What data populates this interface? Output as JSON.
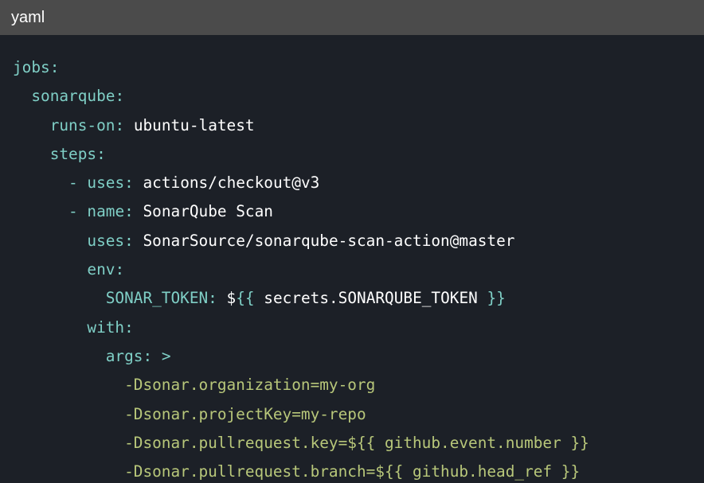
{
  "header": {
    "language": "yaml"
  },
  "code": {
    "lines": [
      {
        "key": "jobs",
        "sep": ":"
      },
      {
        "key": "sonarqube",
        "sep": ":"
      },
      {
        "key": "runs-on",
        "sep": ":",
        "value": "ubuntu-latest"
      },
      {
        "key": "steps",
        "sep": ":"
      },
      {
        "dash": "-",
        "key": "uses",
        "sep": ":",
        "value": "actions/checkout@v3"
      },
      {
        "dash": "-",
        "key": "name",
        "sep": ":",
        "value": "SonarQube Scan"
      },
      {
        "key": "uses",
        "sep": ":",
        "value": "SonarSource/sonarqube-scan-action@master"
      },
      {
        "key": "env",
        "sep": ":"
      },
      {
        "key": "SONAR_TOKEN",
        "sep": ":",
        "value_prefix": "$",
        "tmpl_open": "{{",
        "value_inner": "secrets.SONARQUBE_TOKEN",
        "tmpl_close": "}}"
      },
      {
        "key": "with",
        "sep": ":"
      },
      {
        "key": "args",
        "sep": ":",
        "folded": ">"
      },
      {
        "text": "-Dsonar.organization=my-org"
      },
      {
        "text": "-Dsonar.projectKey=my-repo"
      },
      {
        "text": "-Dsonar.pullrequest.key=${{ github.event.number }}"
      },
      {
        "text": "-Dsonar.pullrequest.branch=${{ github.head_ref }}"
      }
    ]
  },
  "colors": {
    "background": "#1c2027",
    "header_background": "#4b4b4b",
    "key": "#7fcfc6",
    "value": "#ffffff",
    "string": "#b8c77a"
  }
}
